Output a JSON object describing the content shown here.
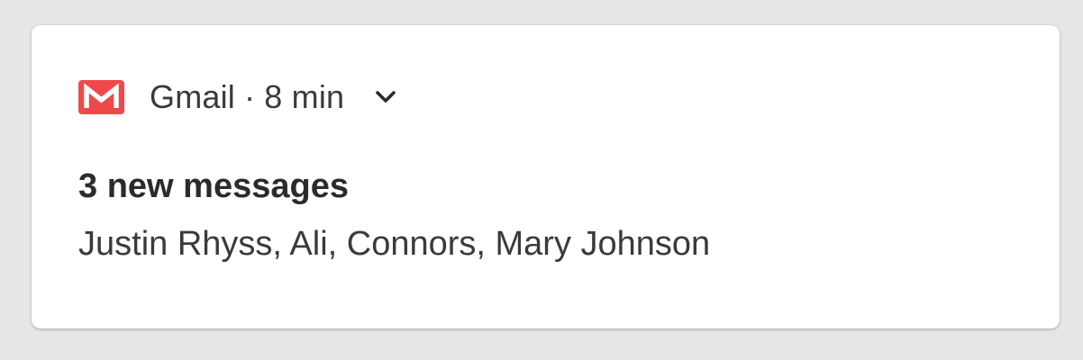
{
  "notification": {
    "app_name": "Gmail",
    "separator": "·",
    "time": "8 min",
    "title": "3 new messages",
    "senders": "Justin Rhyss, Ali, Connors, Mary Johnson",
    "icons": {
      "app": "gmail-icon",
      "expand": "chevron-down-icon"
    },
    "colors": {
      "app_icon_bg": "#f0484a",
      "app_icon_fg": "#ffffff",
      "card_bg": "#ffffff",
      "page_bg": "#e6e6e6"
    }
  }
}
